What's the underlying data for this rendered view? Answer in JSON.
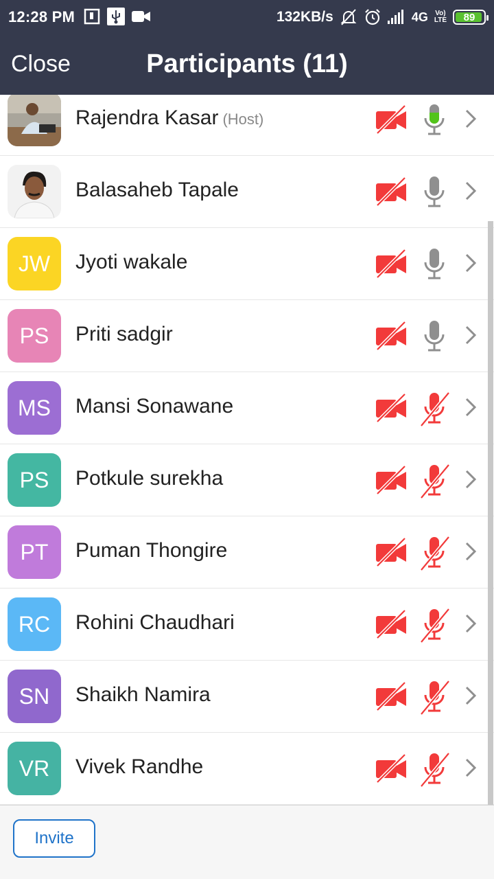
{
  "status_bar": {
    "time": "12:28 PM",
    "speed": "132KB/s",
    "network": "4G",
    "volte_top": "Vo)",
    "volte_bottom": "LTE",
    "battery": "89"
  },
  "header": {
    "close_label": "Close",
    "title": "Participants (11)"
  },
  "colors": {
    "header_bg": "#353a4d",
    "muted_red": "#f23a3a",
    "mic_active_green": "#52c41a",
    "mic_gray": "#8f8f8f",
    "invite_blue": "#1f73c9"
  },
  "participants": [
    {
      "name": "Rajendra Kasar",
      "role": "(Host)",
      "initials": "",
      "avatar_color": "",
      "photo": true,
      "video": "off",
      "mic": "speaking"
    },
    {
      "name": "Balasaheb Tapale",
      "role": "",
      "initials": "",
      "avatar_color": "",
      "photo": true,
      "video": "off",
      "mic": "on"
    },
    {
      "name": "Jyoti wakale",
      "role": "",
      "initials": "JW",
      "avatar_color": "#fbd524",
      "video": "off",
      "mic": "on"
    },
    {
      "name": "Priti sadgir",
      "role": "",
      "initials": "PS",
      "avatar_color": "#e785b6",
      "video": "off",
      "mic": "on"
    },
    {
      "name": "Mansi Sonawane",
      "role": "",
      "initials": "MS",
      "avatar_color": "#9c6ed3",
      "video": "off",
      "mic": "muted"
    },
    {
      "name": "Potkule surekha",
      "role": "",
      "initials": "PS",
      "avatar_color": "#44b7a2",
      "video": "off",
      "mic": "muted"
    },
    {
      "name": "Puman Thongire",
      "role": "",
      "initials": "PT",
      "avatar_color": "#c07bdb",
      "video": "off",
      "mic": "muted"
    },
    {
      "name": "Rohini Chaudhari",
      "role": "",
      "initials": "RC",
      "avatar_color": "#5bb8f6",
      "video": "off",
      "mic": "muted"
    },
    {
      "name": "Shaikh Namira",
      "role": "",
      "initials": "SN",
      "avatar_color": "#9068cd",
      "video": "off",
      "mic": "muted"
    },
    {
      "name": "Vivek Randhe",
      "role": "",
      "initials": "VR",
      "avatar_color": "#45b3a3",
      "video": "off",
      "mic": "muted"
    }
  ],
  "footer": {
    "invite_label": "Invite"
  }
}
